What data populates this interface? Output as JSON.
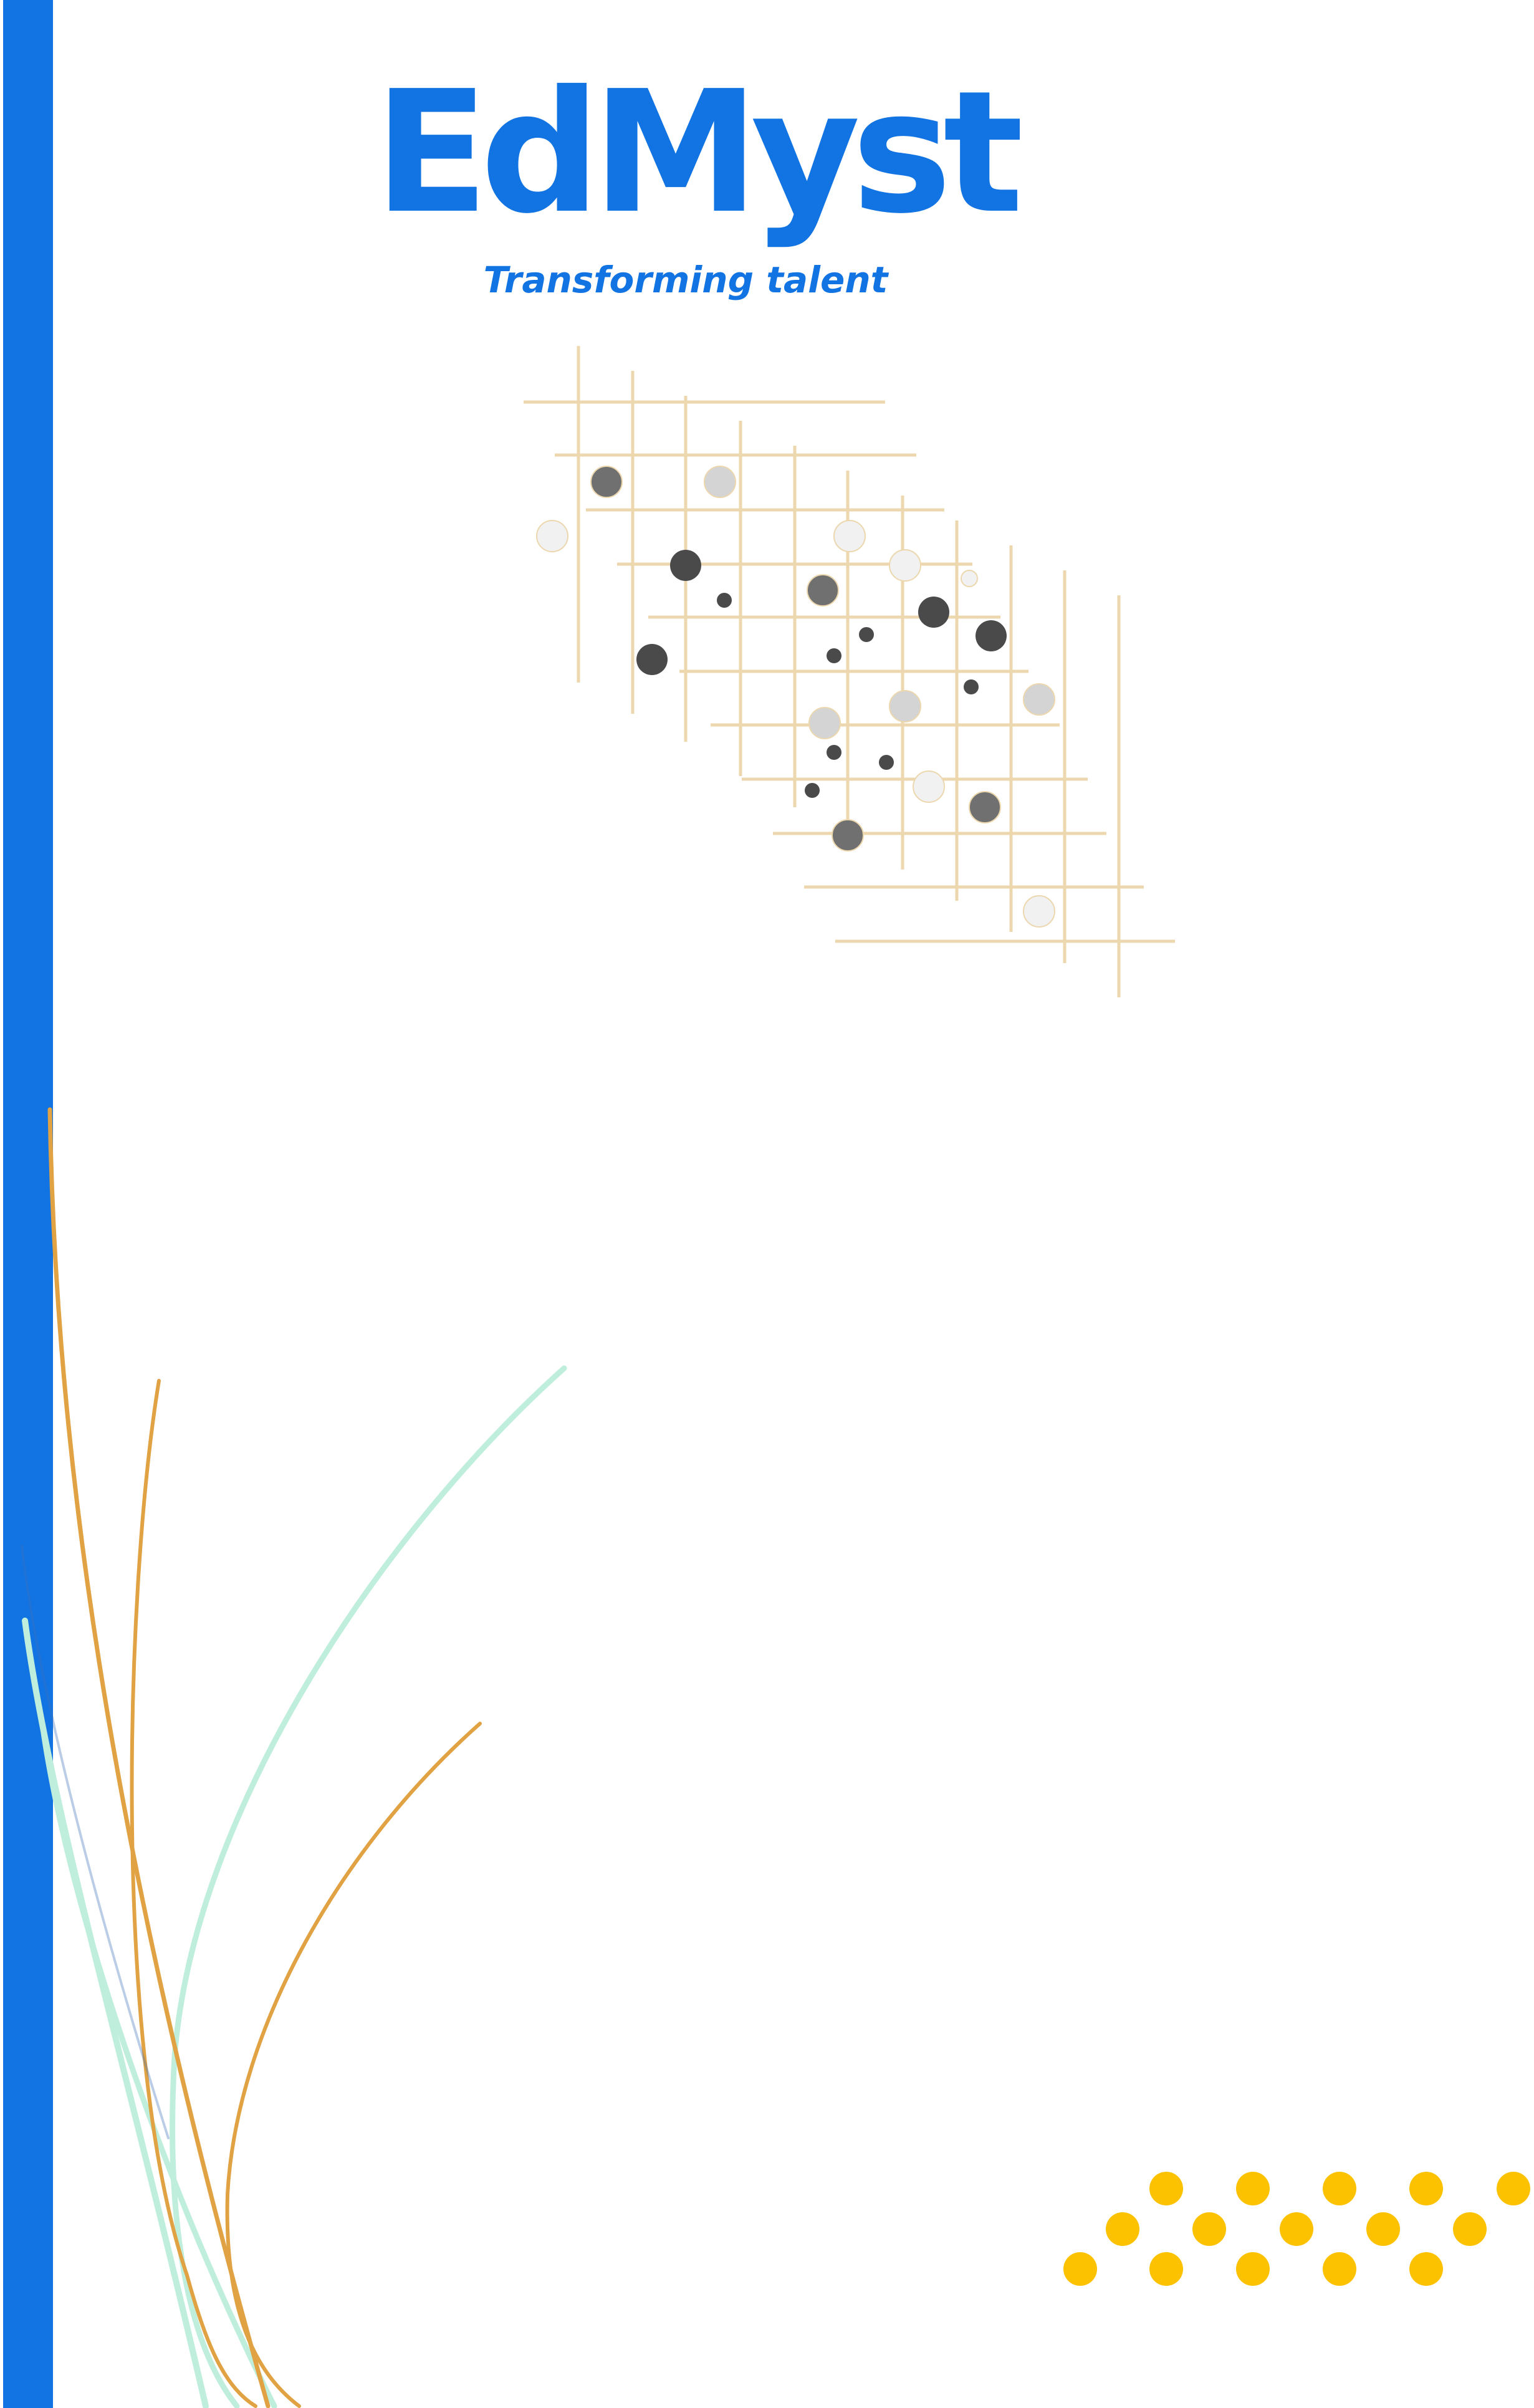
{
  "brand": {
    "name": "EdMyst",
    "tagline": "Transforming talent"
  },
  "colors": {
    "primary_blue": "#1273e3",
    "grid_line": "#ecd7ae",
    "dark_dot": "#4a4a4a",
    "mid_dot": "#707070",
    "light_dot": "#d4d4d4",
    "pale_dot": "#f1f1f1",
    "yellow_dot": "#fcc200",
    "swoosh_orange": "#e0a243",
    "swoosh_mint": "#bfeedd"
  },
  "decorations": {
    "grid_pattern": "dotted-grid-graphic",
    "corner_dots": "yellow-dot-cluster",
    "swooshes": "curved-line-swooshes"
  }
}
